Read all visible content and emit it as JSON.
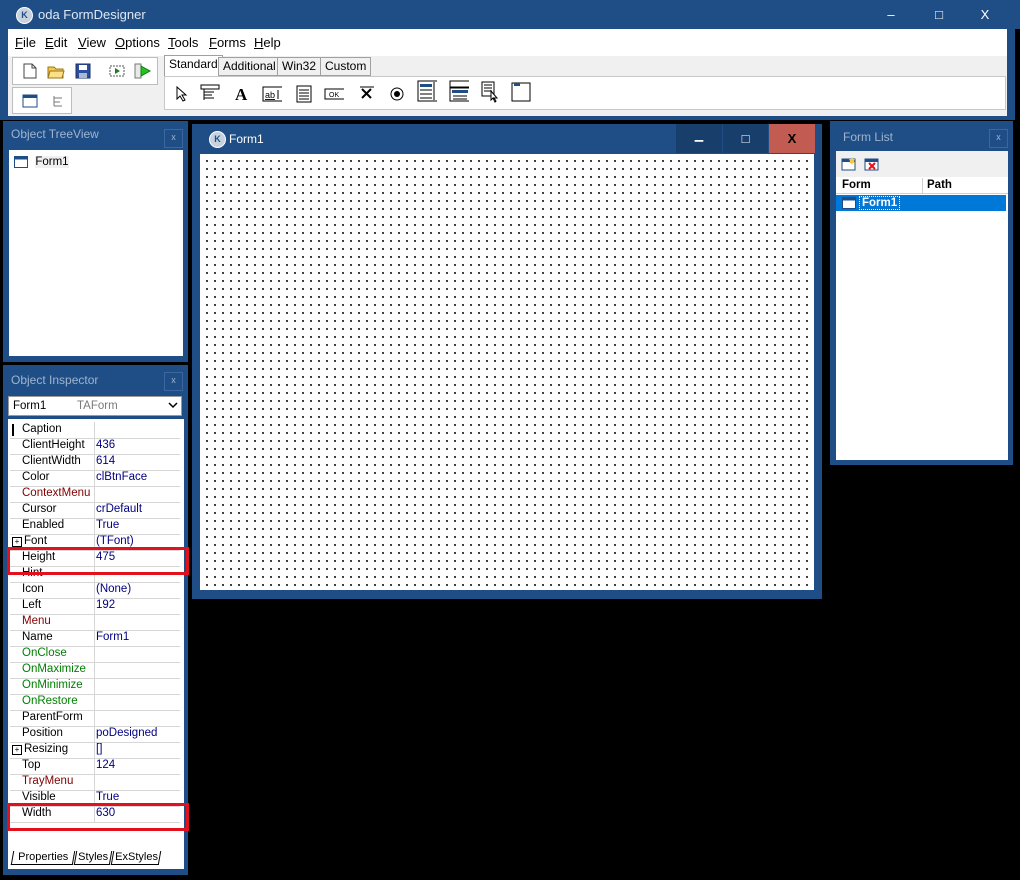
{
  "app": {
    "title": "oda FormDesigner",
    "minimize": "–",
    "maximize": "□",
    "close": "X"
  },
  "menu": [
    {
      "label": "File",
      "u": "F",
      "rest": "ile"
    },
    {
      "label": "Edit",
      "u": "E",
      "rest": "dit"
    },
    {
      "label": "View",
      "u": "V",
      "rest": "iew"
    },
    {
      "label": "Options",
      "u": "O",
      "rest": "ptions"
    },
    {
      "label": "Tools",
      "u": "T",
      "rest": "ools"
    },
    {
      "label": "Forms",
      "u": "F",
      "rest": "orms"
    },
    {
      "label": "Help",
      "u": "H",
      "rest": "elp"
    }
  ],
  "palette_tabs": [
    "Standard",
    "Additional",
    "Win32",
    "Custom"
  ],
  "tree": {
    "title": "Object TreeView",
    "close": "x",
    "item": "Form1"
  },
  "inspector": {
    "title": "Object Inspector",
    "close": "x",
    "selector_name": "Form1",
    "selector_type": "TAForm",
    "rows": [
      {
        "name": "Caption",
        "value": ""
      },
      {
        "name": "ClientHeight",
        "value": "436"
      },
      {
        "name": "ClientWidth",
        "value": "614"
      },
      {
        "name": "Color",
        "value": "clBtnFace"
      },
      {
        "name": "ContextMenu",
        "value": ""
      },
      {
        "name": "Cursor",
        "value": "crDefault"
      },
      {
        "name": "Enabled",
        "value": "True"
      },
      {
        "name": "Font",
        "value": "(TFont)"
      },
      {
        "name": "Height",
        "value": "475"
      },
      {
        "name": "Hint",
        "value": ""
      },
      {
        "name": "Icon",
        "value": "(None)"
      },
      {
        "name": "Left",
        "value": "192"
      },
      {
        "name": "Menu",
        "value": ""
      },
      {
        "name": "Name",
        "value": "Form1"
      },
      {
        "name": "OnClose",
        "value": ""
      },
      {
        "name": "OnMaximize",
        "value": ""
      },
      {
        "name": "OnMinimize",
        "value": ""
      },
      {
        "name": "OnRestore",
        "value": ""
      },
      {
        "name": "ParentForm",
        "value": ""
      },
      {
        "name": "Position",
        "value": "poDesigned"
      },
      {
        "name": "Resizing",
        "value": "[]"
      },
      {
        "name": "Top",
        "value": "124"
      },
      {
        "name": "TrayMenu",
        "value": ""
      },
      {
        "name": "Visible",
        "value": "True"
      },
      {
        "name": "Width",
        "value": "630"
      }
    ],
    "tabs": [
      "Properties",
      "Styles",
      "ExStyles"
    ]
  },
  "form1": {
    "title": "Form1",
    "minimize": "▁",
    "maximize": "□",
    "close": "X"
  },
  "formlist": {
    "title": "Form List",
    "close": "x",
    "col_form": "Form",
    "col_path": "Path",
    "item": "Form1"
  },
  "colors": {
    "title_blue": "#1f4e86",
    "close_red": "#c42b1c",
    "highlight_red": "#e3101e",
    "select_blue": "#0078d7"
  }
}
